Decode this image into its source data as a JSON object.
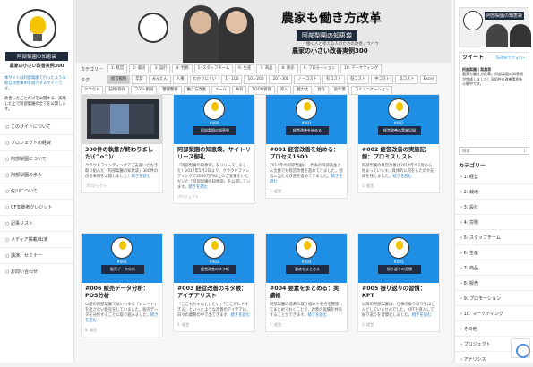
{
  "left": {
    "site_title": "阿部梨園の知恵袋",
    "site_sub": "農家の小さい改善実例300",
    "intro": "本サイトは阿部梨園で行ったような経営改善事例を紹介するサイトです。",
    "intro2": "改善したことだけを公開する、実践した上で阿部梨園の全てを公開します。",
    "nav": [
      "このサイトについて",
      "プロジェクトの経緯",
      "阿部梨園について",
      "阿部梨園の歩み",
      "佐川について",
      "CF支援者クレジット",
      "記事リスト",
      "メディア掲載/出演",
      "講演、セミナー",
      "お問い合わせ"
    ]
  },
  "hero": {
    "title": "農家も働き方改革",
    "ribbon": "阿部梨園の知恵袋",
    "tagline": "働く人と考える人のための改善ノウハウ",
    "sub": "農家の小さい改善実例300"
  },
  "filters": {
    "category_label": "カテゴリー",
    "categories": [
      "1: 経営",
      "2: 栽培",
      "3: 設計",
      "4: 労務",
      "5: スタッフチーム",
      "6: 生産",
      "7: 商品",
      "8: 販売",
      "9: プロモーション",
      "10: マーケティング"
    ],
    "tag_label": "タグ",
    "tags": [
      "経営戦略",
      "年賀",
      "みんたん",
      "人事",
      "わかりにくい",
      "1 - 100",
      "101-200",
      "201-300",
      "ノーコスト",
      "有コスト",
      "低コスト",
      "中コスト",
      "高コスト",
      "Excel",
      "クラウド",
      "記録/保存",
      "コスト削減",
      "整理整頓",
      "働き方改善",
      "メール",
      "共有",
      "TODO管理",
      "導入",
      "魅力化",
      "合作",
      "庭作業",
      "コミュニケーション"
    ]
  },
  "cards": [
    {
      "type": "photo",
      "title": "300件の執筆が終わりました\\(^o^)/",
      "text": "クラウドファンディングでご支援いただき取り組んだ「阿部梨園の知恵袋」300件の改善事例を公開しました！",
      "more": "続きを読む",
      "foot": "プロジェクト"
    },
    {
      "type": "blue",
      "num": "#000",
      "box": "阿部梨園の知恵袋",
      "title": "阿部梨園の知恵袋、サイトリリース御礼",
      "text": "「阿部梨園の知恵袋」をリリースしました！2017年5月2日より、クラウドファンディングで2000万円以上のご支援をいただいた「阿部梨園の知恵袋」を公開しています。",
      "more": "続きを読む",
      "foot": "プロジェクト"
    },
    {
      "type": "blue",
      "num": "#001",
      "box": "経営改善を始める",
      "title": "#001 経営改善を始める：プロセス1500",
      "text": "2014年の阿部梨園は、代表の阿部英生さん全員でも経営改善を進めてきました。個別に当たる改善を進めてきました。",
      "more": "続きを読む",
      "foot": "1: 経営"
    },
    {
      "type": "blue",
      "num": "#002",
      "box": "経営改善の実施記録",
      "title": "#002 経営改善の実施記録：プロミスリスト",
      "text": "阿部梨園の経営改善は2014年の2月から始まっています。具体的に何をしたのか記録を残しました。",
      "more": "続きを読む",
      "foot": "1: 経営"
    },
    {
      "type": "blue",
      "num": "#006",
      "box": "販売データ分析",
      "title": "#006 販売データ分析：POS分析",
      "text": "以前の阿部梨園ではいわゆる「レシート」を出さない販売をしていました。販売データを分析することに取り組みました。",
      "more": "続きを読む",
      "foot": "8: 販売"
    },
    {
      "type": "blue",
      "num": "#003",
      "box": "経営改善のネタ帳",
      "title": "#003 経営改善のネタ帳：アイデアリスト",
      "text": "「ここもちゃんとしたい」「ここがヒドすぎる」といったような改善のアイデアは、日々の業務の中で出てきます。",
      "more": "続きを読む",
      "foot": "1: 経営"
    },
    {
      "type": "blue",
      "num": "#004",
      "box": "要点をまとめる",
      "title": "#004 要素をまとめる：実績帳",
      "text": "阿部梨園の過去の取り組みや要点を整理してまとめておくことで、改善の実績を共有することができます。",
      "more": "続きを読む",
      "foot": "1: 経営"
    },
    {
      "type": "blue",
      "num": "#005",
      "box": "振り返りの習慣",
      "title": "#005 振り返りの習慣：KPT",
      "text": "以前の阿部梨園は、仕事の振り返りをほとんどしていませんでした。KPTを導入して振り返りを習慣化しました。",
      "more": "続きを読む",
      "foot": "1: 経営"
    }
  ],
  "right": {
    "banner_title": "阿部梨園の知恵袋",
    "tw_title": "ツイート",
    "tw_link": "Twitterでフォロー",
    "tw_user": "阿部梨園 | 梨農家",
    "tw_text": "農家も働き方改革。阿部梨園の知恵袋が完成しました！300件の改善実例を公開中です。",
    "search_placeholder": "検索",
    "cat_heading": "カテゴリー",
    "categories": [
      "1: 経営",
      "2: 栽培",
      "3: 設計",
      "4: 労務",
      "5: スタッフチーム",
      "6: 生産",
      "7: 商品",
      "8: 販売",
      "9: プロモーション",
      "10: マーケティング",
      "その他",
      "プロジェクト",
      "アナリシス"
    ]
  }
}
